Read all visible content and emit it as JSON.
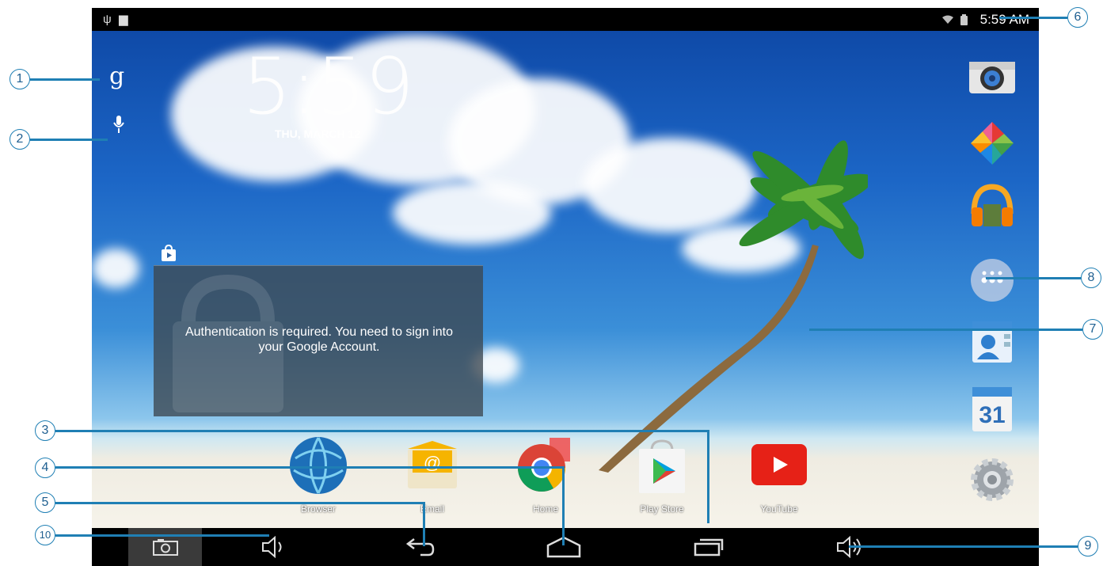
{
  "status_bar": {
    "time": "5:59 AM",
    "left_icons": [
      "usb-icon",
      "storage-icon"
    ],
    "right_icons": [
      "wifi-icon",
      "battery-icon"
    ]
  },
  "clock": {
    "time": "5:59",
    "date": "THU, MARCH 12"
  },
  "search": {
    "icons": [
      "google-search-icon",
      "voice-search-icon"
    ]
  },
  "auth_widget": {
    "message": "Authentication is required. You need to sign into your Google Account."
  },
  "dock": [
    {
      "label": "Browser",
      "icon": "browser-globe-icon"
    },
    {
      "label": "Email",
      "icon": "email-icon"
    },
    {
      "label": "Home",
      "icon": "chrome-icon"
    },
    {
      "label": "Play Store",
      "icon": "play-store-icon"
    },
    {
      "label": "YouTube",
      "icon": "youtube-icon"
    }
  ],
  "side_apps": [
    {
      "icon": "camera-icon"
    },
    {
      "icon": "photos-pinwheel-icon"
    },
    {
      "icon": "music-headphones-icon"
    },
    {
      "icon": "all-apps-icon"
    },
    {
      "icon": "contacts-icon"
    },
    {
      "icon": "calendar-icon",
      "day": "31"
    },
    {
      "icon": "settings-gear-icon"
    }
  ],
  "nav_bar": {
    "buttons": [
      "screenshot-icon",
      "volume-down-icon",
      "back-icon",
      "home-icon",
      "recent-apps-icon",
      "volume-up-icon"
    ]
  },
  "callouts": [
    "1",
    "2",
    "3",
    "4",
    "5",
    "6",
    "7",
    "8",
    "9",
    "10"
  ],
  "colors": {
    "callout": "#1f7fb4",
    "status_bar": "#000000",
    "youtube_red": "#e62117",
    "sky": "#1c66c6"
  }
}
